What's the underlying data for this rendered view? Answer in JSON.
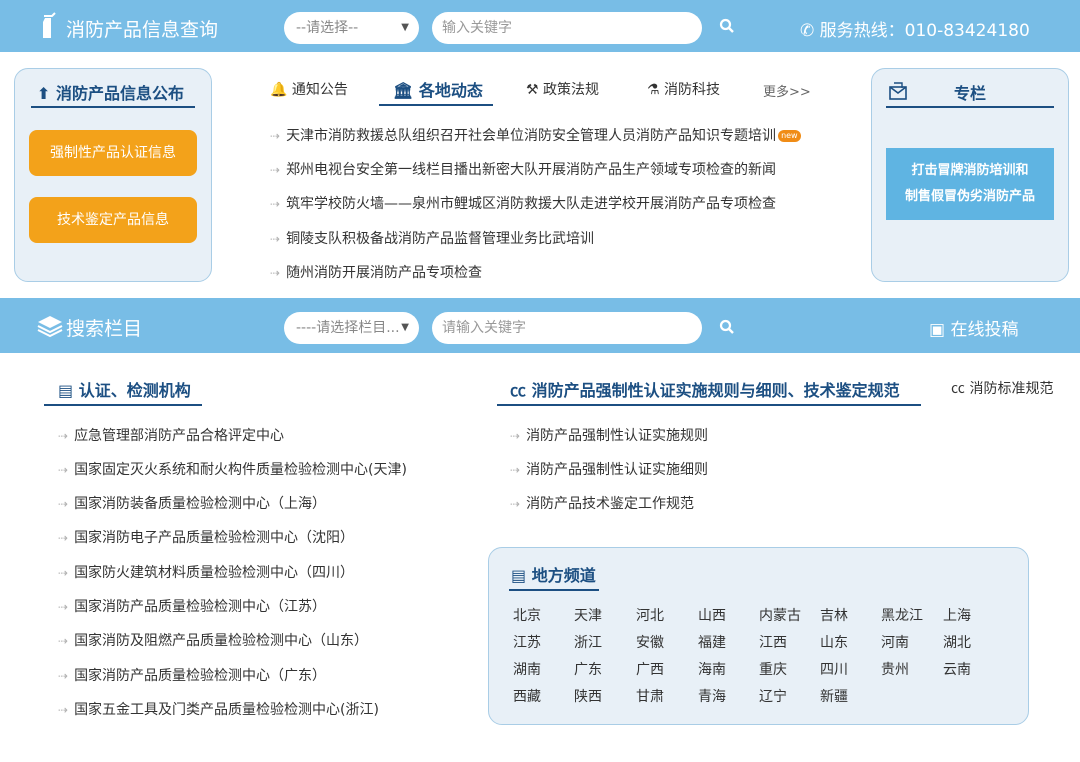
{
  "header": {
    "title": "消防产品信息查询",
    "select_label": "--请选择--",
    "search_placeholder": "输入关键字",
    "hotline": "服务热线：010-83424180"
  },
  "left_panel": {
    "title": "消防产品信息公布",
    "buttons": [
      "强制性产品认证信息",
      "技术鉴定产品信息"
    ]
  },
  "news": {
    "tabs": [
      "通知公告",
      "各地动态",
      "政策法规",
      "消防科技"
    ],
    "active_tab": 1,
    "more": "更多>>",
    "items": [
      "天津市消防救援总队组织召开社会单位消防安全管理人员消防产品知识专题培训",
      "郑州电视台安全第一线栏目播出新密大队开展消防产品生产领域专项检查的新闻",
      "筑牢学校防火墙——泉州市鲤城区消防救援大队走进学校开展消防产品专项检查",
      "铜陵支队积极备战消防产品监督管理业务比武培训",
      "随州消防开展消防产品专项检查"
    ],
    "new_badge": "new"
  },
  "right_panel": {
    "title": "专栏",
    "banner_line1": "打击冒牌消防培训和",
    "banner_line2": "制售假冒伪劣消防产品"
  },
  "search_bar": {
    "title": "搜索栏目",
    "select_label": "----请选择栏目...",
    "search_placeholder": "请输入关键字",
    "submit_label": "在线投稿"
  },
  "orgs": {
    "title": "认证、检测机构",
    "items": [
      "应急管理部消防产品合格评定中心",
      "国家固定灭火系统和耐火构件质量检验检测中心(天津)",
      "国家消防装备质量检验检测中心（上海）",
      "国家消防电子产品质量检验检测中心（沈阳）",
      "国家防火建筑材料质量检验检测中心（四川）",
      "国家消防产品质量检验检测中心（江苏）",
      "国家消防及阻燃产品质量检验检测中心（山东）",
      "国家消防产品质量检验检测中心（广东）",
      "国家五金工具及门类产品质量检验检测中心(浙江)"
    ]
  },
  "rules": {
    "title": "消防产品强制性认证实施规则与细则、技术鉴定规范",
    "side_link": "消防标准规范",
    "items": [
      "消防产品强制性认证实施规则",
      "消防产品强制性认证实施细则",
      "消防产品技术鉴定工作规范"
    ]
  },
  "regions": {
    "title": "地方频道",
    "rows": [
      [
        "北京",
        "天津",
        "河北",
        "山西",
        "内蒙古",
        "吉林",
        "黑龙江",
        "上海"
      ],
      [
        "江苏",
        "浙江",
        "安徽",
        "福建",
        "江西",
        "山东",
        "河南",
        "湖北"
      ],
      [
        "湖南",
        "广东",
        "广西",
        "海南",
        "重庆",
        "四川",
        "贵州",
        "云南"
      ],
      [
        "西藏",
        "陕西",
        "甘肃",
        "青海",
        "辽宁",
        "新疆"
      ]
    ]
  },
  "colors": {
    "header_bg": "#78bde6",
    "navy": "#1c4f82",
    "orange": "#f3a21a"
  }
}
